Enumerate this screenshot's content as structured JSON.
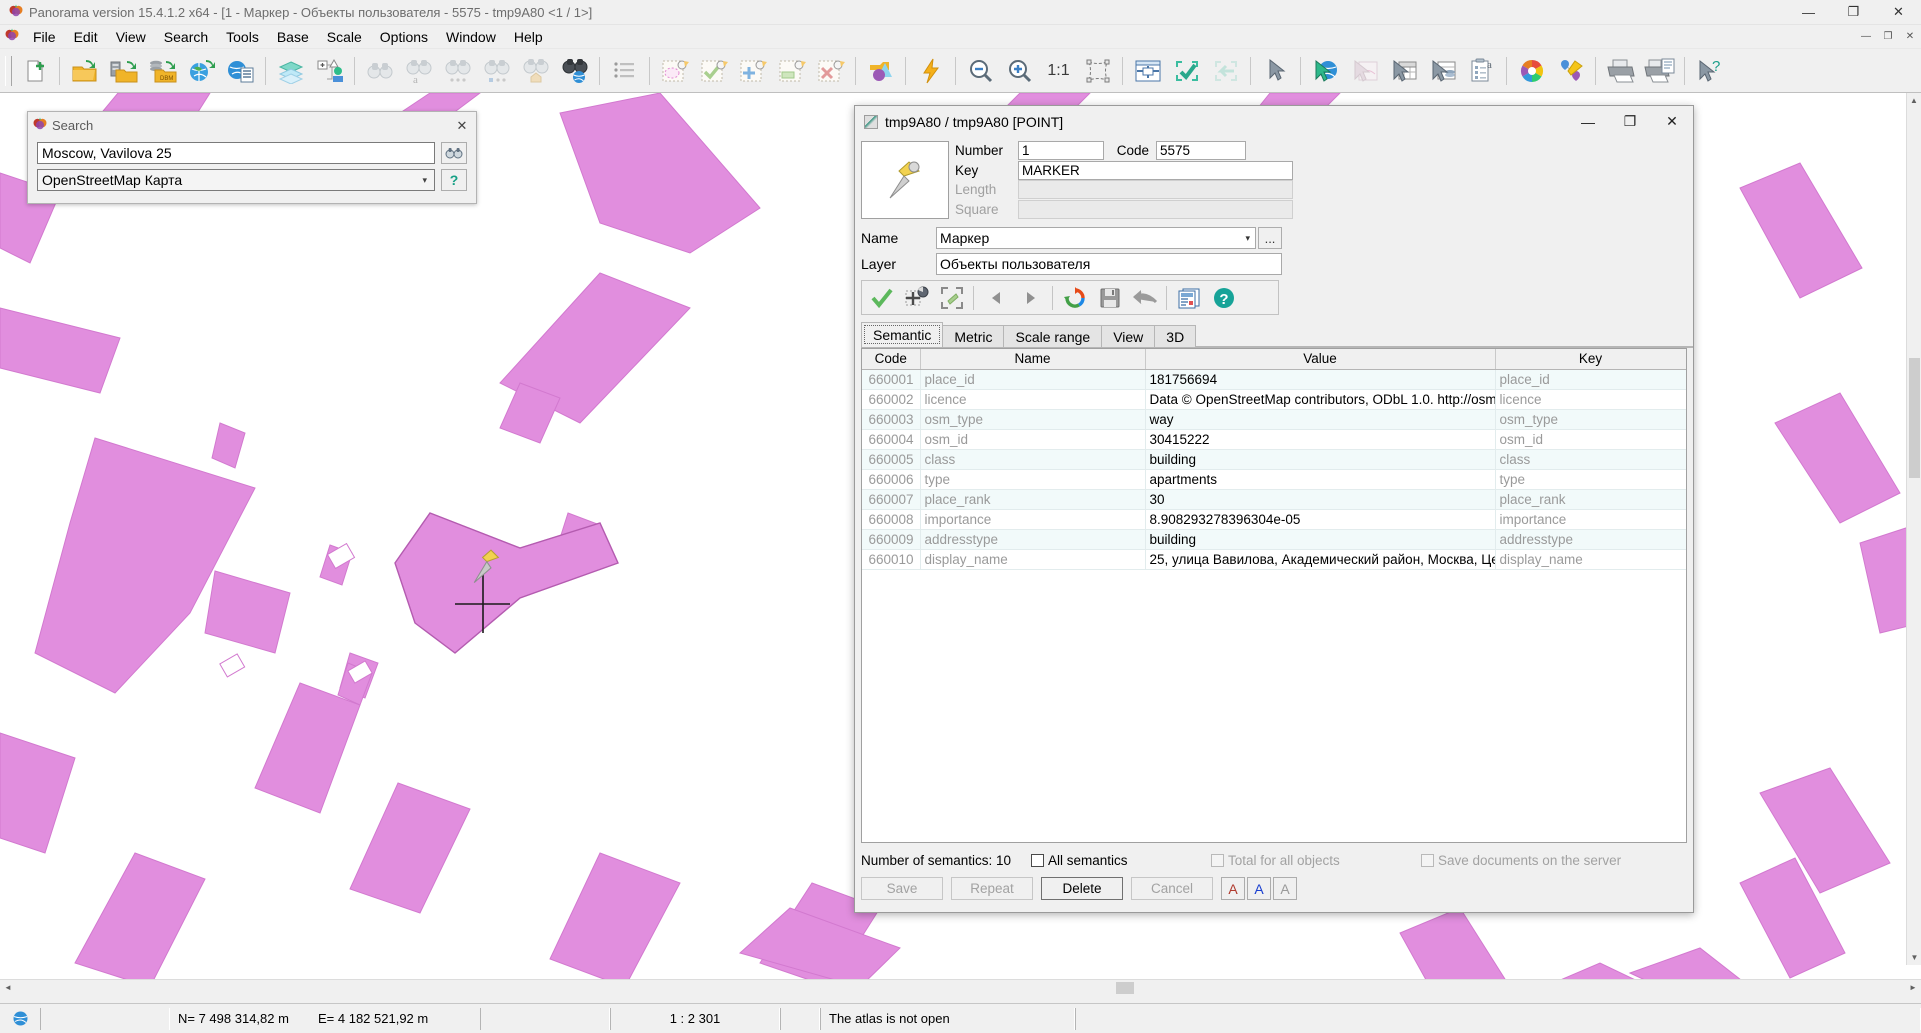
{
  "app": {
    "title": "Panorama version 15.4.1.2 x64 - [1 - Маркер - Объекты пользователя - 5575 - tmp9A80 <1 / 1>]",
    "icon": "panorama-app-icon",
    "minimize": "—",
    "maximize": "❐",
    "close": "✕",
    "inner_minimize": "—",
    "inner_maximize": "❐",
    "inner_close": "✕"
  },
  "menubar": {
    "items": [
      {
        "label": "File"
      },
      {
        "label": "Edit"
      },
      {
        "label": "View"
      },
      {
        "label": "Search"
      },
      {
        "label": "Tools"
      },
      {
        "label": "Base"
      },
      {
        "label": "Scale"
      },
      {
        "label": "Options"
      },
      {
        "label": "Window"
      },
      {
        "label": "Help"
      }
    ]
  },
  "toolbar": {
    "groups": [
      {
        "buttons": [
          {
            "name": "new-document-icon",
            "tip": "New document"
          }
        ]
      },
      {
        "buttons": [
          {
            "name": "open-folder-icon",
            "tip": "Open map"
          },
          {
            "name": "open-server-folder-icon",
            "tip": "Open from server"
          },
          {
            "name": "open-dbm-folder-icon",
            "tip": "Open DBM"
          },
          {
            "name": "open-globe-icon",
            "tip": "Open geoportal"
          },
          {
            "name": "globe-list-icon",
            "tip": "Map list"
          }
        ]
      },
      {
        "buttons": [
          {
            "name": "layers-icon",
            "tip": "Layers"
          },
          {
            "name": "object-tree-add-icon",
            "tip": "Add object tree"
          }
        ]
      },
      {
        "buttons": [
          {
            "name": "binoculars-icon",
            "tip": "Find object"
          },
          {
            "name": "binoculars-text-icon",
            "tip": "Find by text"
          },
          {
            "name": "binoculars-dots-icon",
            "tip": "Find next"
          },
          {
            "name": "binoculars-square-icon",
            "tip": "Find in area"
          },
          {
            "name": "binoculars-home-icon",
            "tip": "Find address"
          },
          {
            "name": "binoculars-globe-icon",
            "tip": "Search on map"
          }
        ]
      },
      {
        "buttons": [
          {
            "name": "list-icon",
            "tip": "Object list"
          }
        ]
      },
      {
        "buttons": [
          {
            "name": "select-area-icon",
            "tip": "Select area"
          },
          {
            "name": "select-check-icon",
            "tip": "Confirm selection"
          },
          {
            "name": "add-point-icon",
            "tip": "Create object"
          },
          {
            "name": "edit-object-icon",
            "tip": "Edit object"
          },
          {
            "name": "delete-object-icon",
            "tip": "Delete object"
          }
        ]
      },
      {
        "buttons": [
          {
            "name": "3d-view-icon",
            "tip": "3D view"
          }
        ]
      },
      {
        "buttons": [
          {
            "name": "lightning-icon",
            "tip": "Quick action"
          }
        ]
      },
      {
        "buttons": [
          {
            "name": "zoom-out-icon",
            "tip": "Zoom out"
          },
          {
            "name": "zoom-in-icon",
            "tip": "Zoom in"
          },
          {
            "name": "zoom-1-1-icon",
            "tip": "Actual size",
            "label": "1:1"
          },
          {
            "name": "fit-frame-icon",
            "tip": "Fit to window"
          }
        ]
      },
      {
        "buttons": [
          {
            "name": "panel-icon",
            "tip": "Panels"
          },
          {
            "name": "apply-check-icon",
            "tip": "Apply"
          },
          {
            "name": "back-arrow-icon",
            "tip": "Back"
          }
        ]
      },
      {
        "buttons": [
          {
            "name": "cursor-icon",
            "tip": "Pointer"
          }
        ]
      },
      {
        "buttons": [
          {
            "name": "cursor-globe-icon",
            "tip": "Select on geoportal"
          },
          {
            "name": "cursor-map-icon",
            "tip": "Select on map"
          },
          {
            "name": "cursor-table-icon",
            "tip": "Select in table"
          },
          {
            "name": "cursor-db-icon",
            "tip": "Select in database"
          },
          {
            "name": "report-text-icon",
            "tip": "Report"
          }
        ]
      },
      {
        "buttons": [
          {
            "name": "color-wheel-icon",
            "tip": "Colors"
          },
          {
            "name": "measure-icon",
            "tip": "Measure"
          }
        ]
      },
      {
        "buttons": [
          {
            "name": "print-icon",
            "tip": "Print"
          },
          {
            "name": "print-report-icon",
            "tip": "Print report"
          }
        ]
      },
      {
        "buttons": [
          {
            "name": "help-cursor-icon",
            "tip": "Context help"
          }
        ]
      }
    ]
  },
  "search_dialog": {
    "icon": "panorama-app-icon",
    "title": "Search",
    "close": "✕",
    "query_value": "Moscow, Vavilova 25",
    "query_placeholder": "",
    "search_button_icon": "binoculars-icon",
    "provider_value": "OpenStreetMap Карта",
    "help_button_label": "?"
  },
  "object_dialog": {
    "title": "tmp9A80 / tmp9A80 [POINT]",
    "preview_icon": "map-pin-marker-icon",
    "fields": {
      "number_label": "Number",
      "number_value": "1",
      "code_label": "Code",
      "code_value": "5575",
      "key_label": "Key",
      "key_value": "MARKER",
      "length_label": "Length",
      "length_value": "",
      "square_label": "Square",
      "square_value": "",
      "name_label": "Name",
      "name_value": "Маркер",
      "name_browse_label": "...",
      "layer_label": "Layer",
      "layer_value": "Объекты пользователя"
    },
    "inner_toolbar": [
      {
        "name": "apply-check-icon",
        "tip": "Save object"
      },
      {
        "name": "add-point-object-icon",
        "tip": "Create object"
      },
      {
        "name": "fit-object-icon",
        "tip": "Show whole object"
      },
      {
        "name": "prev-object-icon",
        "tip": "Previous object"
      },
      {
        "name": "next-object-icon",
        "tip": "Next object"
      },
      {
        "name": "refresh-icon",
        "tip": "Refresh"
      },
      {
        "name": "save-disk-icon",
        "tip": "Save"
      },
      {
        "name": "undo-arrow-icon",
        "tip": "Undo"
      },
      {
        "name": "report-icon",
        "tip": "Report"
      },
      {
        "name": "help-icon",
        "tip": "Help"
      }
    ],
    "tabs": [
      {
        "label": "Semantic",
        "active": true
      },
      {
        "label": "Metric",
        "active": false
      },
      {
        "label": "Scale range",
        "active": false
      },
      {
        "label": "View",
        "active": false
      },
      {
        "label": "3D",
        "active": false
      }
    ],
    "table": {
      "columns": [
        "Code",
        "Name",
        "Value",
        "Key"
      ],
      "rows": [
        {
          "code": "660001",
          "name": "place_id",
          "value": "181756694",
          "key": "place_id"
        },
        {
          "code": "660002",
          "name": "licence",
          "value": "Data © OpenStreetMap contributors, ODbL 1.0. http://osm",
          "key": "licence"
        },
        {
          "code": "660003",
          "name": "osm_type",
          "value": "way",
          "key": "osm_type"
        },
        {
          "code": "660004",
          "name": "osm_id",
          "value": "30415222",
          "key": "osm_id"
        },
        {
          "code": "660005",
          "name": "class",
          "value": "building",
          "key": "class"
        },
        {
          "code": "660006",
          "name": "type",
          "value": "apartments",
          "key": "type"
        },
        {
          "code": "660007",
          "name": "place_rank",
          "value": "30",
          "key": "place_rank"
        },
        {
          "code": "660008",
          "name": "importance",
          "value": "8.908293278396304e-05",
          "key": "importance"
        },
        {
          "code": "660009",
          "name": "addresstype",
          "value": "building",
          "key": "addresstype"
        },
        {
          "code": "660010",
          "name": "display_name",
          "value": "25, улица Вавилова, Академический район, Москва, Це",
          "key": "display_name"
        }
      ]
    },
    "footer": {
      "semantics_count_label": "Number of semantics: 10",
      "all_semantics_label": "All semantics",
      "total_for_all_label": "Total for all objects",
      "save_on_server_label": "Save documents on the server",
      "buttons": [
        {
          "label": "Save",
          "enabled": false
        },
        {
          "label": "Repeat",
          "enabled": false
        },
        {
          "label": "Delete",
          "enabled": true
        },
        {
          "label": "Cancel",
          "enabled": false
        }
      ],
      "font_buttons": [
        {
          "label": "A",
          "color": "#b03a2e"
        },
        {
          "label": "A",
          "color": "#1a3fd0"
        },
        {
          "label": "A",
          "color": "#9a9a9a"
        }
      ]
    }
  },
  "statusbar": {
    "globe_icon": "globe-icon",
    "north": "N= 7 498 314,82 m",
    "east": "E= 4 182 521,92 m",
    "scale": "1 : 2 301",
    "atlas": "The atlas is not open",
    "extra": ""
  },
  "map": {
    "background_color": "#ffffff",
    "building_fill": "#e18ede",
    "building_stroke": "#d97fd6",
    "marker_name": "map-marker-pin"
  },
  "scrollbars": {
    "h_left": "◄",
    "h_right": "►",
    "v_up": "▲",
    "v_down": "▼"
  }
}
